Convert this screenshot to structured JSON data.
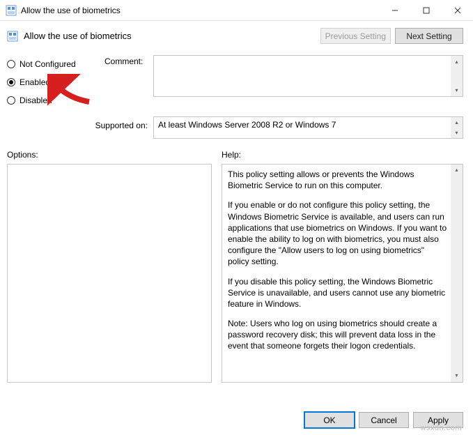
{
  "window": {
    "title": "Allow the use of biometrics"
  },
  "header": {
    "title": "Allow the use of biometrics",
    "previous_setting": "Previous Setting",
    "next_setting": "Next Setting"
  },
  "config": {
    "not_configured": "Not Configured",
    "enabled": "Enabled",
    "disabled": "Disabled",
    "selected": "enabled",
    "comment_label": "Comment:",
    "comment_value": "",
    "supported_label": "Supported on:",
    "supported_value": "At least Windows Server 2008 R2 or Windows 7"
  },
  "panes": {
    "options_label": "Options:",
    "help_label": "Help:",
    "options_value": "",
    "help": {
      "p1": "This policy setting allows or prevents the Windows Biometric Service to run on this computer.",
      "p2": "If you enable or do not configure this policy setting, the Windows Biometric Service is available, and users can run applications that use biometrics on Windows. If you want to enable the ability to log on with biometrics, you must also configure the \"Allow users to log on using biometrics\" policy setting.",
      "p3": "If you disable this policy setting, the Windows Biometric Service is unavailable, and users cannot use any biometric feature in Windows.",
      "p4": "Note: Users who log on using biometrics should create a password recovery disk; this will prevent data loss in the event that someone forgets their logon credentials."
    }
  },
  "footer": {
    "ok": "OK",
    "cancel": "Cancel",
    "apply": "Apply"
  },
  "watermark": "wsxdn.com"
}
